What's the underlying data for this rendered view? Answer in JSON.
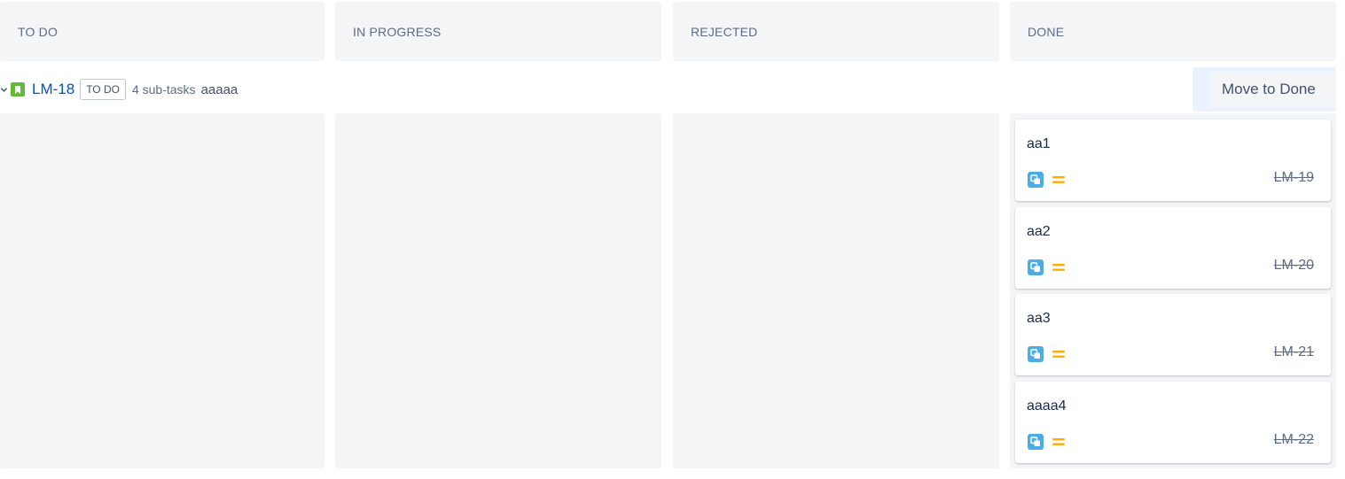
{
  "columns": [
    {
      "title": "TO DO"
    },
    {
      "title": "IN PROGRESS"
    },
    {
      "title": "REJECTED"
    },
    {
      "title": "DONE"
    }
  ],
  "swimlane": {
    "key": "LM-18",
    "status": "TO DO",
    "subtask_count": "4 sub-tasks",
    "summary": "aaaaa",
    "move_button": "Move to Done"
  },
  "cards": [
    {
      "title": "aa1",
      "key": "LM-19",
      "type_icon": "subtask-icon",
      "priority_icon": "priority-medium-icon"
    },
    {
      "title": "aa2",
      "key": "LM-20",
      "type_icon": "subtask-icon",
      "priority_icon": "priority-medium-icon"
    },
    {
      "title": "aa3",
      "key": "LM-21",
      "type_icon": "subtask-icon",
      "priority_icon": "priority-medium-icon"
    },
    {
      "title": "aaaa4",
      "key": "LM-22",
      "type_icon": "subtask-icon",
      "priority_icon": "priority-medium-icon"
    }
  ],
  "colors": {
    "column_bg": "#f4f5f7",
    "link": "#0052cc",
    "story_icon": "#63ba3c",
    "subtask_icon": "#4bade8",
    "priority_medium": "#ffab00"
  }
}
